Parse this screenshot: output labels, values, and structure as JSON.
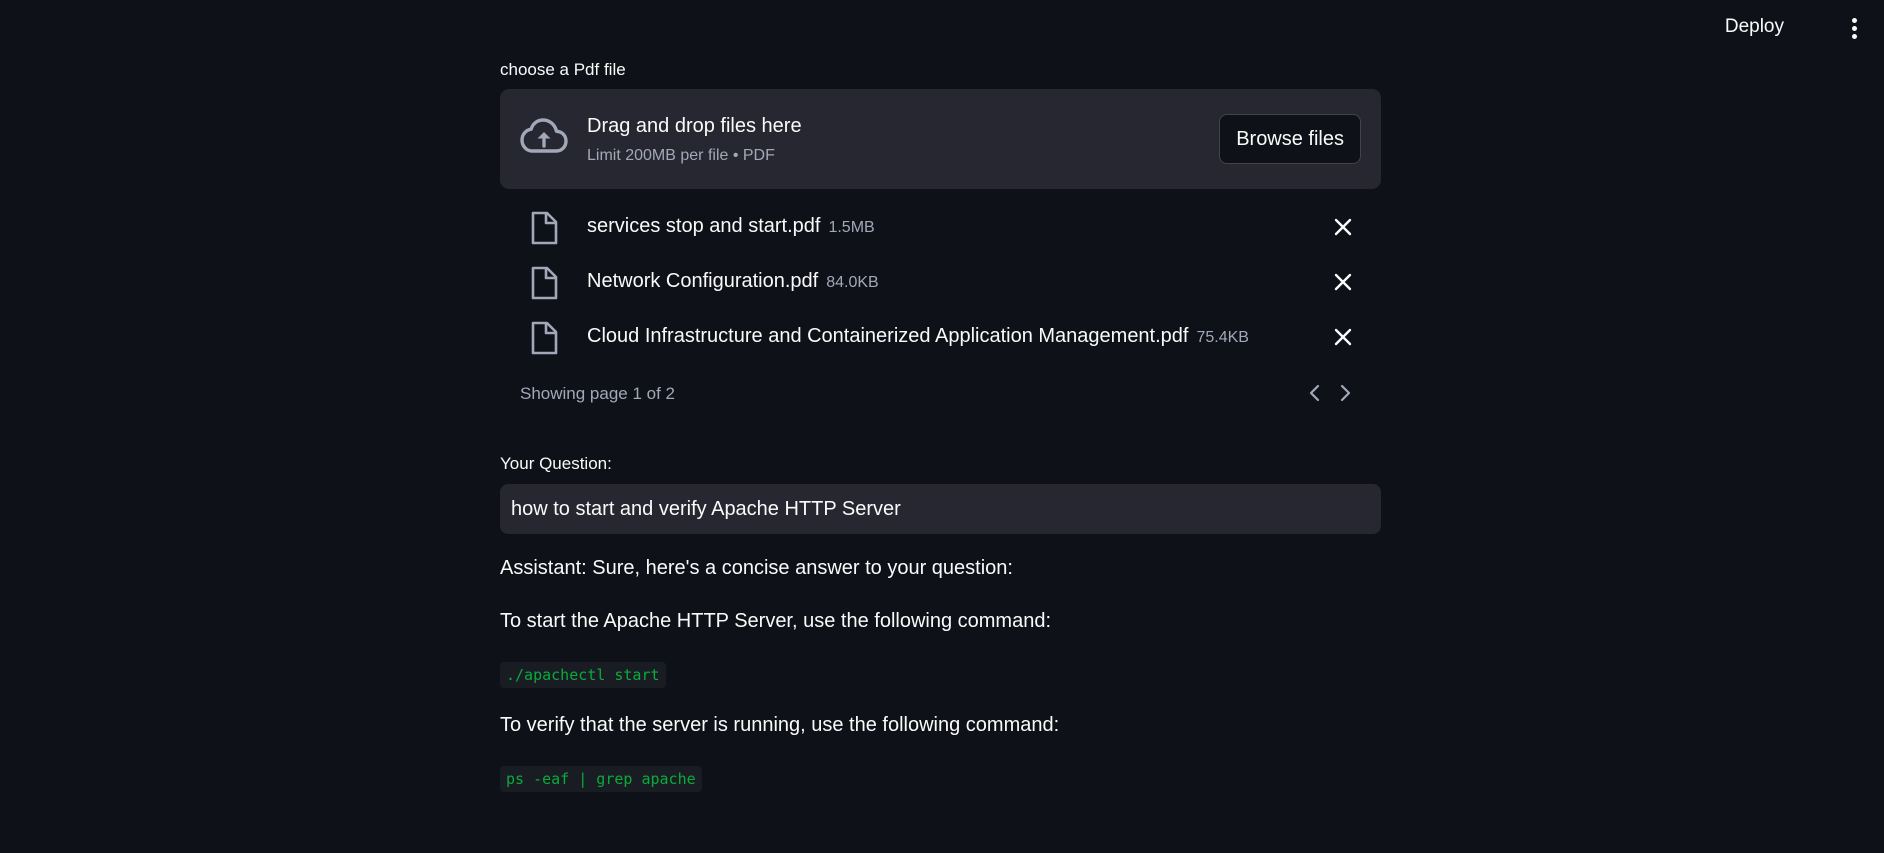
{
  "header": {
    "deploy_label": "Deploy",
    "menu_icon": "more-vertical-icon"
  },
  "uploader": {
    "label": "choose a Pdf file",
    "drop_title": "Drag and drop files here",
    "drop_subtitle": "Limit 200MB per file • PDF",
    "browse_label": "Browse files",
    "upload_icon": "cloud-upload-icon",
    "files": [
      {
        "name": "services stop and start.pdf",
        "size": "1.5MB"
      },
      {
        "name": "Network Configuration.pdf",
        "size": "84.0KB"
      },
      {
        "name": "Cloud Infrastructure and Containerized Application Management.pdf",
        "size": "75.4KB"
      }
    ],
    "pagination": "Showing page 1 of 2"
  },
  "question": {
    "label": "Your Question:",
    "value": "how to start and verify Apache HTTP Server"
  },
  "answer": {
    "intro": "Assistant: Sure, here's a concise answer to your question:",
    "start_text": "To start the Apache HTTP Server, use the following command:",
    "start_code": "./apachectl start",
    "verify_text": "To verify that the server is running, use the following command:",
    "verify_code": "ps -eaf | grep apache"
  },
  "colors": {
    "background": "#0e1117",
    "surface": "#262730",
    "text": "#fafafa",
    "muted": "#a3a8b8",
    "code_green": "#09ab3b"
  }
}
